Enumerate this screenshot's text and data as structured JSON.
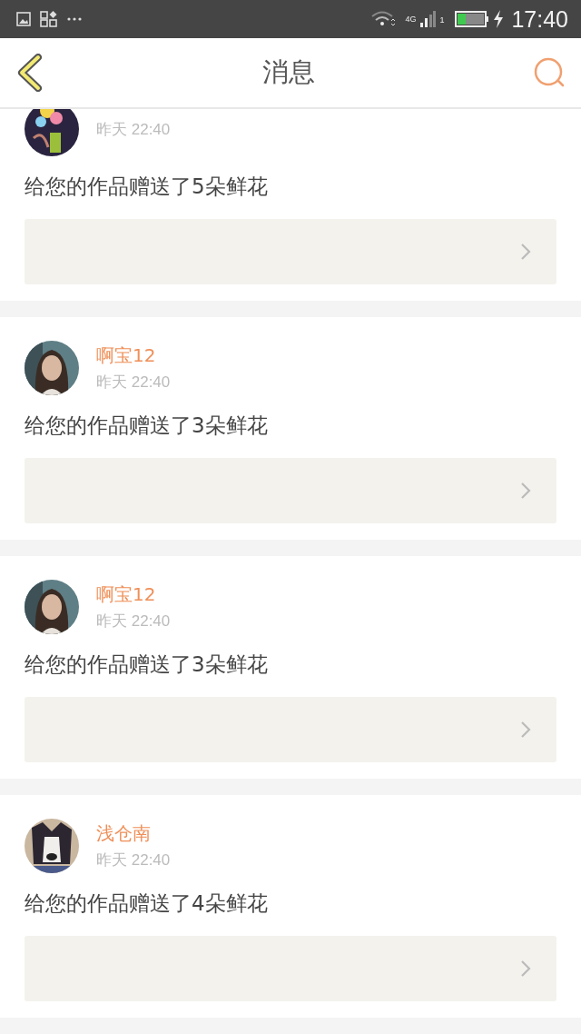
{
  "status_bar": {
    "network": "4G",
    "sim": "1",
    "time": "17:40"
  },
  "header": {
    "title": "消息"
  },
  "messages": [
    {
      "time": "昨天 22:40",
      "text": "给您的作品赠送了5朵鲜花"
    },
    {
      "name": "啊宝12",
      "time": "昨天 22:40",
      "text": "给您的作品赠送了3朵鲜花"
    },
    {
      "name": "啊宝12",
      "time": "昨天 22:40",
      "text": "给您的作品赠送了3朵鲜花"
    },
    {
      "name": "浅仓南",
      "time": "昨天 22:40",
      "text": "给您的作品赠送了4朵鲜花"
    }
  ]
}
